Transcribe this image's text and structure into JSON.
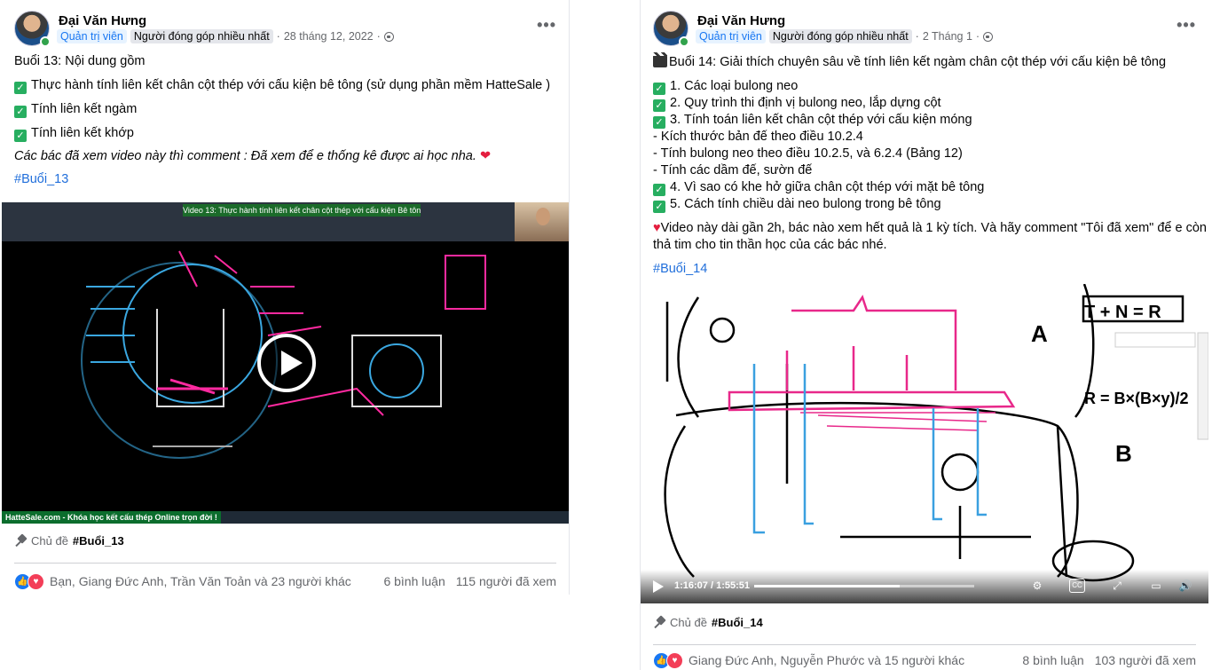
{
  "posts": [
    {
      "author": "Đại Văn Hưng",
      "badge_admin": "Quản trị viên",
      "badge_contributor": "Người đóng góp nhiều nhất",
      "date": "28 tháng 12, 2022",
      "lines": {
        "title": "Buổi 13: Nội dung gồm",
        "item1": "Thực hành tính liên kết chân cột thép với cấu kiện bê tông (sử dụng phần mềm HatteSale )",
        "item2": "Tính liên kết ngàm",
        "item3": "Tính liên kết khớp",
        "note": "Các bác đã xem video này thì comment : Đã xem để e thống kê được ai học nha.",
        "hashtag": "#Buổi_13"
      },
      "video": {
        "banner": "Video 13: Thực hành tính liên kết chân cột thép với cấu kiện Bê tông",
        "footer": "HatteSale.com - Khóa học kết cấu thép Online trọn đời !"
      },
      "topic_label": "Chủ đề",
      "topic": "#Buổi_13",
      "reactions_names": "Bạn, Giang Đức Anh, Trần Văn Toản và 23 người khác",
      "comments": "6 bình luận",
      "views": "115 người đã xem"
    },
    {
      "author": "Đại Văn Hưng",
      "badge_admin": "Quản trị viên",
      "badge_contributor": "Người đóng góp nhiều nhất",
      "date": "2 Tháng 1",
      "lines": {
        "title": "Buổi 14: Giải thích chuyên sâu về tính liên kết ngàm chân cột thép với cấu kiện bê tông",
        "item1": "1. Các loại bulong neo",
        "item2": "2. Quy trình thi định vị bulong neo, lắp dựng cột",
        "item3": "3. Tính toán liên kết chân cột thép với cấu kiện móng",
        "sub1": "- Kích thước bản đế theo điều 10.2.4",
        "sub2": "- Tính bulong neo theo điều 10.2.5, và 6.2.4 (Bảng 12)",
        "sub3": "- Tính các dầm đế, sườn đế",
        "item4": "4. Vì sao có khe hở giữa chân cột thép với mặt bê tông",
        "item5": "5. Cách tính chiều dài neo bulong trong bê tông",
        "note1": "Video này dài gần 2h, bác nào xem hết quả là 1 kỳ tích. Và hãy comment \"Tôi đã xem\" để e còn",
        "note2": "thả tim cho tin thần học của các bác nhé.",
        "hashtag": "#Buổi_14"
      },
      "video": {
        "time": "1:16:07 / 1:55:51",
        "progress": 0.66
      },
      "topic_label": "Chủ đề",
      "topic": "#Buổi_14",
      "reactions_names": "Giang Đức Anh, Nguyễn Phước và 15 người khác",
      "comments": "8 bình luận",
      "views": "103 người đã xem"
    }
  ],
  "icons": {
    "more": "more-horizontal-icon",
    "globe": "globe-icon",
    "check": "check-box-icon",
    "pin": "pin-icon",
    "like": "like-reaction-icon",
    "love": "love-reaction-icon"
  },
  "colors": {
    "link": "#216fdb",
    "like": "#1877f2",
    "love": "#f33e58",
    "check": "#27ae60"
  }
}
